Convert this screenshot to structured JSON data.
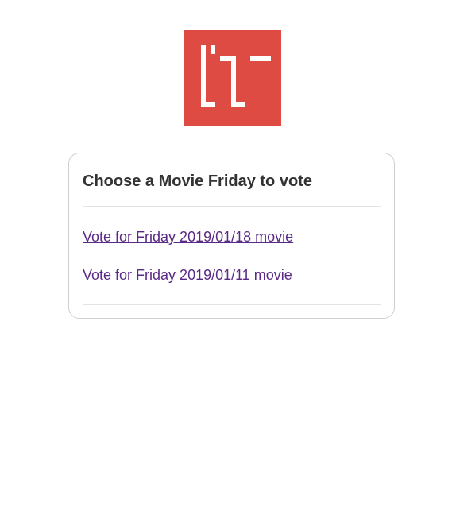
{
  "logo": {
    "icon": "brand-logo-icon",
    "background_color": "#dd4b42",
    "mark_color": "#ffffff"
  },
  "card": {
    "title": "Choose a Movie Friday to vote",
    "links": [
      {
        "label": "Vote for Friday 2019/01/18 movie"
      },
      {
        "label": "Vote for Friday 2019/01/11 movie"
      }
    ]
  },
  "colors": {
    "link": "#5b2a86",
    "title": "#333333",
    "card_border": "#cfcfcf"
  }
}
